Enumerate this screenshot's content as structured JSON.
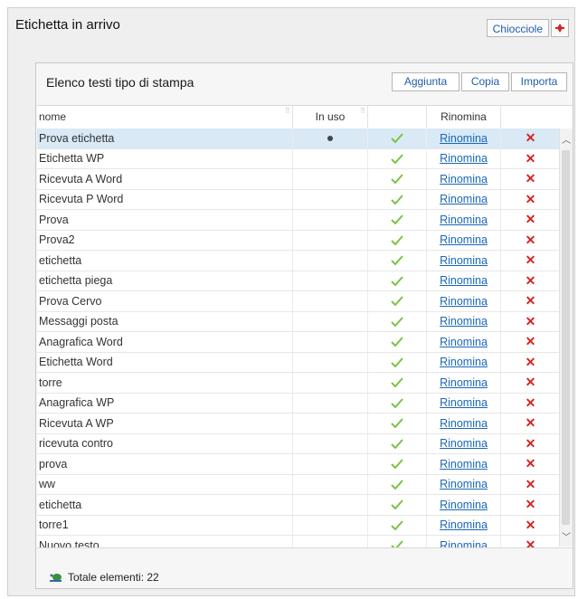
{
  "window": {
    "title": "Etichetta in arrivo",
    "chiocciole_label": "Chiocciole"
  },
  "panel": {
    "title": "Elenco testi tipo di stampa",
    "buttons": {
      "add": "Aggiunta",
      "copy": "Copia",
      "import": "Importa"
    }
  },
  "grid": {
    "headers": {
      "name": "nome",
      "in_use": "In uso",
      "check": "",
      "rename": "Rinomina",
      "delete": ""
    },
    "rename_label": "Rinomina",
    "rows": [
      {
        "name": "Prova etichetta",
        "in_use": true,
        "selected": true
      },
      {
        "name": "Etichetta WP",
        "in_use": false
      },
      {
        "name": "Ricevuta A Word",
        "in_use": false
      },
      {
        "name": "Ricevuta P Word",
        "in_use": false
      },
      {
        "name": "Prova",
        "in_use": false
      },
      {
        "name": "Prova2",
        "in_use": false
      },
      {
        "name": "etichetta",
        "in_use": false
      },
      {
        "name": "etichetta piega",
        "in_use": false
      },
      {
        "name": "Prova Cervo",
        "in_use": false
      },
      {
        "name": "Messaggi posta",
        "in_use": false
      },
      {
        "name": "Anagrafica Word",
        "in_use": false
      },
      {
        "name": "Etichetta Word",
        "in_use": false
      },
      {
        "name": "torre",
        "in_use": false
      },
      {
        "name": "Anagrafica WP",
        "in_use": false
      },
      {
        "name": "Ricevuta A WP",
        "in_use": false
      },
      {
        "name": "ricevuta contro",
        "in_use": false
      },
      {
        "name": "prova",
        "in_use": false
      },
      {
        "name": "ww",
        "in_use": false
      },
      {
        "name": "etichetta",
        "in_use": false
      },
      {
        "name": "torre1",
        "in_use": false
      },
      {
        "name": "Nuovo testo",
        "in_use": false
      }
    ]
  },
  "footer": {
    "total_label": "Totale elementi: 22"
  },
  "colors": {
    "selected_row": "#d9e9f5",
    "link": "#1a67b8",
    "delete": "#d62424",
    "check": "#7cc242"
  }
}
